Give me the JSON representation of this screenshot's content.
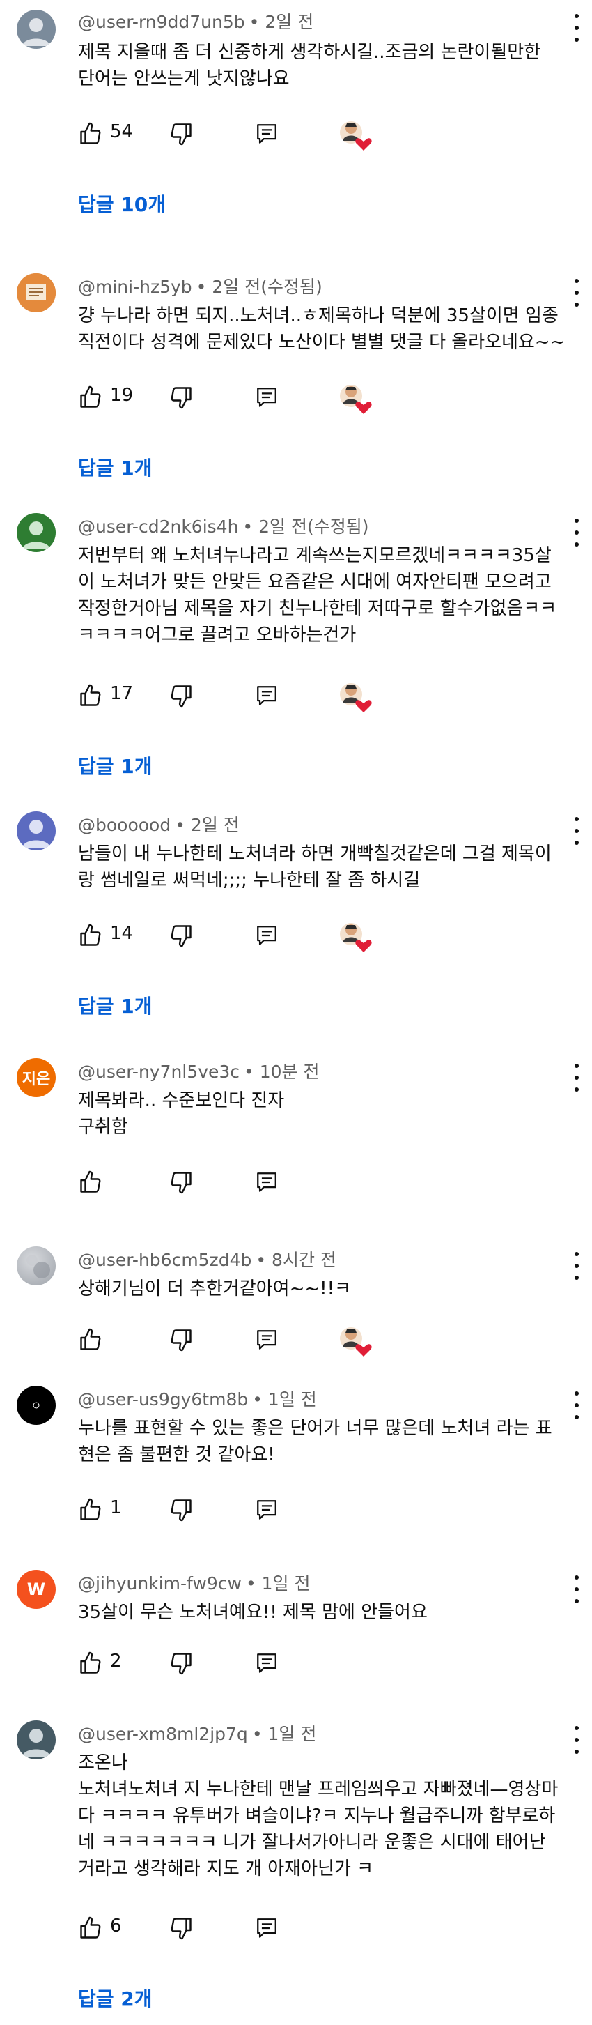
{
  "comments": [
    {
      "handle": "@user-rn9dd7un5b",
      "meta": "• 2일 전",
      "text": "제목 지을때 좀 더 신중하게 생각하시길..조금의 논란이될만한\n단어는 안쓰는게 낫지않나요",
      "likes": "54",
      "creator_heart": true,
      "replies": "답글 10개",
      "avatar": {
        "type": "person",
        "color": "#7b8b9b"
      }
    },
    {
      "handle": "@mini-hz5yb",
      "meta": "• 2일 전(수정됨)",
      "text": "걍 누나라 하면 되지..노처녀..ㅎ제목하나 덕분에 35살이면 임종\n직전이다 성격에 문제있다 노산이다 별별 댓글 다 올라오네요~~",
      "likes": "19",
      "creator_heart": true,
      "replies": "답글 1개",
      "avatar": {
        "type": "image",
        "color": "#e48a3c"
      }
    },
    {
      "handle": "@user-cd2nk6is4h",
      "meta": "• 2일 전(수정됨)",
      "text": "저번부터 왜 노처녀누나라고 계속쓰는지모르겠네ㅋㅋㅋㅋ35살\n이 노처녀가 맞든 안맞든 요즘같은 시대에 여자안티팬 모으려고\n작정한거아님 제목을 자기 친누나한테 저따구로 할수가없음ㅋㅋ\nㅋㅋㅋㅋ어그로 끌려고 오바하는건가",
      "likes": "17",
      "creator_heart": true,
      "replies": "답글 1개",
      "avatar": {
        "type": "person",
        "color": "#2e7d32"
      }
    },
    {
      "handle": "@boooood",
      "meta": "• 2일 전",
      "text": "남들이 내 누나한테 노처녀라 하면 개빡칠것같은데 그걸 제목이\n랑 썸네일로 써먹네;;;; 누나한테 잘 좀 하시길",
      "likes": "14",
      "creator_heart": true,
      "replies": "답글 1개",
      "avatar": {
        "type": "person",
        "color": "#5c6bc0"
      }
    },
    {
      "handle": "@user-ny7nl5ve3c",
      "meta": "• 10분 전",
      "text": "제목봐라.. 수준보인다 진자\n구취함",
      "likes": "",
      "creator_heart": false,
      "replies": "",
      "avatar": {
        "type": "text",
        "color": "#ef6c00",
        "label": "지은"
      }
    },
    {
      "handle": "@user-hb6cm5zd4b",
      "meta": "• 8시간 전",
      "text": "상해기님이 더 추한거같아여~~!!ㅋ",
      "likes": "",
      "creator_heart": true,
      "replies": "",
      "avatar": {
        "type": "image",
        "color": "#b0b4ba"
      }
    },
    {
      "handle": "@user-us9gy6tm8b",
      "meta": "• 1일 전",
      "text": "누나를 표현할 수 있는 좋은 단어가 너무 많은데 노처녀 라는 표\n현은 좀 불편한 것 같아요!",
      "likes": "1",
      "creator_heart": false,
      "replies": "",
      "avatar": {
        "type": "dot",
        "color": "#000000"
      }
    },
    {
      "handle": "@jihyunkim-fw9cw",
      "meta": "• 1일 전",
      "text": "35살이 무슨 노처녀예요!! 제목 맘에 안들어요",
      "likes": "2",
      "creator_heart": false,
      "replies": "",
      "avatar": {
        "type": "text",
        "color": "#f4511e",
        "label": "W"
      }
    },
    {
      "handle": "@user-xm8ml2jp7q",
      "meta": "• 1일 전",
      "text": "조온나\n노처녀노처녀 지 누나한테 맨날 프레임씌우고 자빠졌네—영상마\n다 ㅋㅋㅋㅋ 유투버가 벼슬이냐?ㅋ 지누나 월급주니까 함부로하\n네 ㅋㅋㅋㅋㅋㅋㅋ 니가 잘나서가아니라 운좋은 시대에 태어난\n거라고 생각해라 지도 개 아재아닌가 ㅋ",
      "likes": "6",
      "creator_heart": false,
      "replies": "답글 2개",
      "avatar": {
        "type": "person",
        "color": "#455a64"
      }
    }
  ]
}
